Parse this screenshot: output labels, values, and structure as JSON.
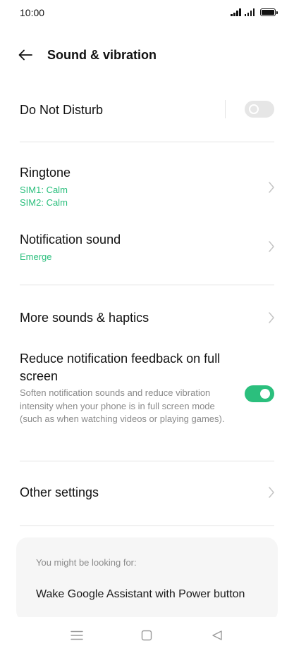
{
  "status_bar": {
    "time": "10:00"
  },
  "header": {
    "title": "Sound & vibration"
  },
  "settings": {
    "do_not_disturb": {
      "label": "Do Not Disturb",
      "enabled": false
    },
    "ringtone": {
      "label": "Ringtone",
      "sim1": "SIM1: Calm",
      "sim2": "SIM2: Calm"
    },
    "notification_sound": {
      "label": "Notification sound",
      "value": "Emerge"
    },
    "more_sounds": {
      "label": "More sounds & haptics"
    },
    "reduce_feedback": {
      "label": "Reduce notification feedback on full screen",
      "description": "Soften notification sounds and reduce vibration intensity when your phone is in full screen mode (such as when watching videos or playing games).",
      "enabled": true
    },
    "other_settings": {
      "label": "Other settings"
    }
  },
  "suggestions": {
    "heading": "You might be looking for:",
    "items": [
      "Wake Google Assistant with Power button"
    ]
  },
  "colors": {
    "accent": "#2bbf7d",
    "toggle_off": "#e6e6e6",
    "card_bg": "#f6f6f6"
  }
}
